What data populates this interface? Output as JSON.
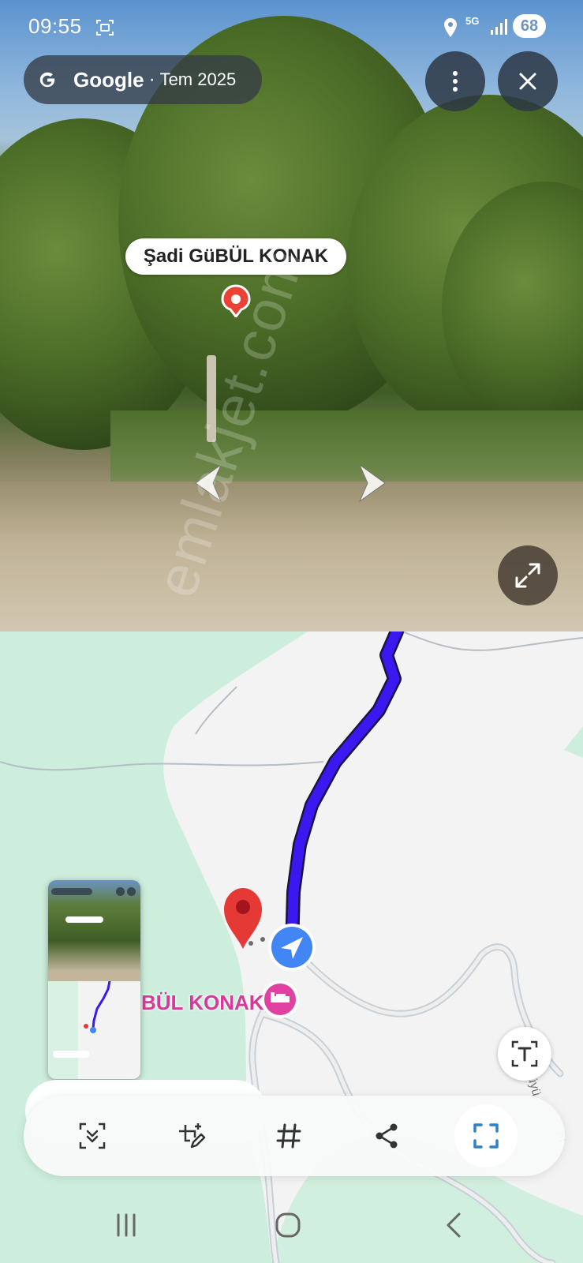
{
  "status_bar": {
    "time": "09:55",
    "network": "5G",
    "battery": "68"
  },
  "street_view": {
    "provider": "Google",
    "separator": "·",
    "date": "Tem 2025",
    "place_label": "Şadi GüBÜL KONAK",
    "watermark": "emlakjet.com"
  },
  "map": {
    "poi_label": "BÜL KONAK",
    "route_color": "#3b18f0",
    "accent_blue": "#4285f4",
    "pin_red": "#e53935",
    "poi_pink": "#e040a0"
  },
  "thumbnail": {
    "place_label": "Şadi GüBÜL KONAK"
  },
  "toolbar": {
    "items": [
      "smart-select-icon",
      "edit-crop-icon",
      "hashtag-icon",
      "share-icon",
      "capture-icon"
    ]
  }
}
